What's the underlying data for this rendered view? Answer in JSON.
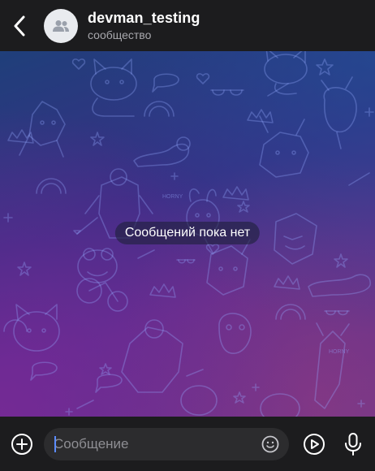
{
  "header": {
    "title": "devman_testing",
    "subtitle": "сообщество",
    "back_icon": "chevron-left-icon",
    "avatar_icon": "community-icon"
  },
  "chat": {
    "empty_text": "Сообщений пока нет",
    "background_colors": [
      "#1f3f7a",
      "#3a2f86",
      "#5a2f8f",
      "#6a3a8a"
    ],
    "pattern_stamps": [
      "HORNY",
      "HORNY"
    ]
  },
  "input": {
    "placeholder": "Сообщение",
    "value": "",
    "attach_icon": "plus-circle-icon",
    "emoji_icon": "smile-icon",
    "video_icon": "play-circle-icon",
    "mic_icon": "microphone-icon",
    "accent": "#5b8cff"
  }
}
